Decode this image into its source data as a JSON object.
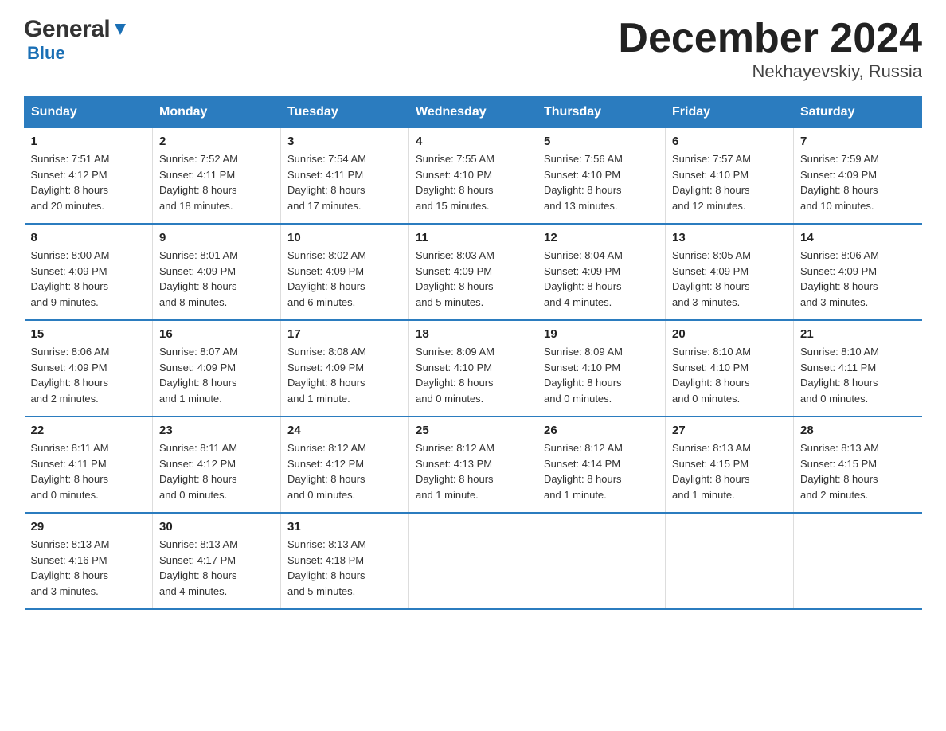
{
  "header": {
    "title": "December 2024",
    "subtitle": "Nekhayevskiy, Russia",
    "logo_general": "General",
    "logo_blue": "Blue"
  },
  "days_of_week": [
    "Sunday",
    "Monday",
    "Tuesday",
    "Wednesday",
    "Thursday",
    "Friday",
    "Saturday"
  ],
  "weeks": [
    [
      {
        "day": "1",
        "sunrise": "7:51 AM",
        "sunset": "4:12 PM",
        "daylight": "8 hours and 20 minutes."
      },
      {
        "day": "2",
        "sunrise": "7:52 AM",
        "sunset": "4:11 PM",
        "daylight": "8 hours and 18 minutes."
      },
      {
        "day": "3",
        "sunrise": "7:54 AM",
        "sunset": "4:11 PM",
        "daylight": "8 hours and 17 minutes."
      },
      {
        "day": "4",
        "sunrise": "7:55 AM",
        "sunset": "4:10 PM",
        "daylight": "8 hours and 15 minutes."
      },
      {
        "day": "5",
        "sunrise": "7:56 AM",
        "sunset": "4:10 PM",
        "daylight": "8 hours and 13 minutes."
      },
      {
        "day": "6",
        "sunrise": "7:57 AM",
        "sunset": "4:10 PM",
        "daylight": "8 hours and 12 minutes."
      },
      {
        "day": "7",
        "sunrise": "7:59 AM",
        "sunset": "4:09 PM",
        "daylight": "8 hours and 10 minutes."
      }
    ],
    [
      {
        "day": "8",
        "sunrise": "8:00 AM",
        "sunset": "4:09 PM",
        "daylight": "8 hours and 9 minutes."
      },
      {
        "day": "9",
        "sunrise": "8:01 AM",
        "sunset": "4:09 PM",
        "daylight": "8 hours and 8 minutes."
      },
      {
        "day": "10",
        "sunrise": "8:02 AM",
        "sunset": "4:09 PM",
        "daylight": "8 hours and 6 minutes."
      },
      {
        "day": "11",
        "sunrise": "8:03 AM",
        "sunset": "4:09 PM",
        "daylight": "8 hours and 5 minutes."
      },
      {
        "day": "12",
        "sunrise": "8:04 AM",
        "sunset": "4:09 PM",
        "daylight": "8 hours and 4 minutes."
      },
      {
        "day": "13",
        "sunrise": "8:05 AM",
        "sunset": "4:09 PM",
        "daylight": "8 hours and 3 minutes."
      },
      {
        "day": "14",
        "sunrise": "8:06 AM",
        "sunset": "4:09 PM",
        "daylight": "8 hours and 3 minutes."
      }
    ],
    [
      {
        "day": "15",
        "sunrise": "8:06 AM",
        "sunset": "4:09 PM",
        "daylight": "8 hours and 2 minutes."
      },
      {
        "day": "16",
        "sunrise": "8:07 AM",
        "sunset": "4:09 PM",
        "daylight": "8 hours and 1 minute."
      },
      {
        "day": "17",
        "sunrise": "8:08 AM",
        "sunset": "4:09 PM",
        "daylight": "8 hours and 1 minute."
      },
      {
        "day": "18",
        "sunrise": "8:09 AM",
        "sunset": "4:10 PM",
        "daylight": "8 hours and 0 minutes."
      },
      {
        "day": "19",
        "sunrise": "8:09 AM",
        "sunset": "4:10 PM",
        "daylight": "8 hours and 0 minutes."
      },
      {
        "day": "20",
        "sunrise": "8:10 AM",
        "sunset": "4:10 PM",
        "daylight": "8 hours and 0 minutes."
      },
      {
        "day": "21",
        "sunrise": "8:10 AM",
        "sunset": "4:11 PM",
        "daylight": "8 hours and 0 minutes."
      }
    ],
    [
      {
        "day": "22",
        "sunrise": "8:11 AM",
        "sunset": "4:11 PM",
        "daylight": "8 hours and 0 minutes."
      },
      {
        "day": "23",
        "sunrise": "8:11 AM",
        "sunset": "4:12 PM",
        "daylight": "8 hours and 0 minutes."
      },
      {
        "day": "24",
        "sunrise": "8:12 AM",
        "sunset": "4:12 PM",
        "daylight": "8 hours and 0 minutes."
      },
      {
        "day": "25",
        "sunrise": "8:12 AM",
        "sunset": "4:13 PM",
        "daylight": "8 hours and 1 minute."
      },
      {
        "day": "26",
        "sunrise": "8:12 AM",
        "sunset": "4:14 PM",
        "daylight": "8 hours and 1 minute."
      },
      {
        "day": "27",
        "sunrise": "8:13 AM",
        "sunset": "4:15 PM",
        "daylight": "8 hours and 1 minute."
      },
      {
        "day": "28",
        "sunrise": "8:13 AM",
        "sunset": "4:15 PM",
        "daylight": "8 hours and 2 minutes."
      }
    ],
    [
      {
        "day": "29",
        "sunrise": "8:13 AM",
        "sunset": "4:16 PM",
        "daylight": "8 hours and 3 minutes."
      },
      {
        "day": "30",
        "sunrise": "8:13 AM",
        "sunset": "4:17 PM",
        "daylight": "8 hours and 4 minutes."
      },
      {
        "day": "31",
        "sunrise": "8:13 AM",
        "sunset": "4:18 PM",
        "daylight": "8 hours and 5 minutes."
      },
      {
        "day": "",
        "sunrise": "",
        "sunset": "",
        "daylight": ""
      },
      {
        "day": "",
        "sunrise": "",
        "sunset": "",
        "daylight": ""
      },
      {
        "day": "",
        "sunrise": "",
        "sunset": "",
        "daylight": ""
      },
      {
        "day": "",
        "sunrise": "",
        "sunset": "",
        "daylight": ""
      }
    ]
  ],
  "labels": {
    "sunrise": "Sunrise: ",
    "sunset": "Sunset: ",
    "daylight": "Daylight: "
  }
}
